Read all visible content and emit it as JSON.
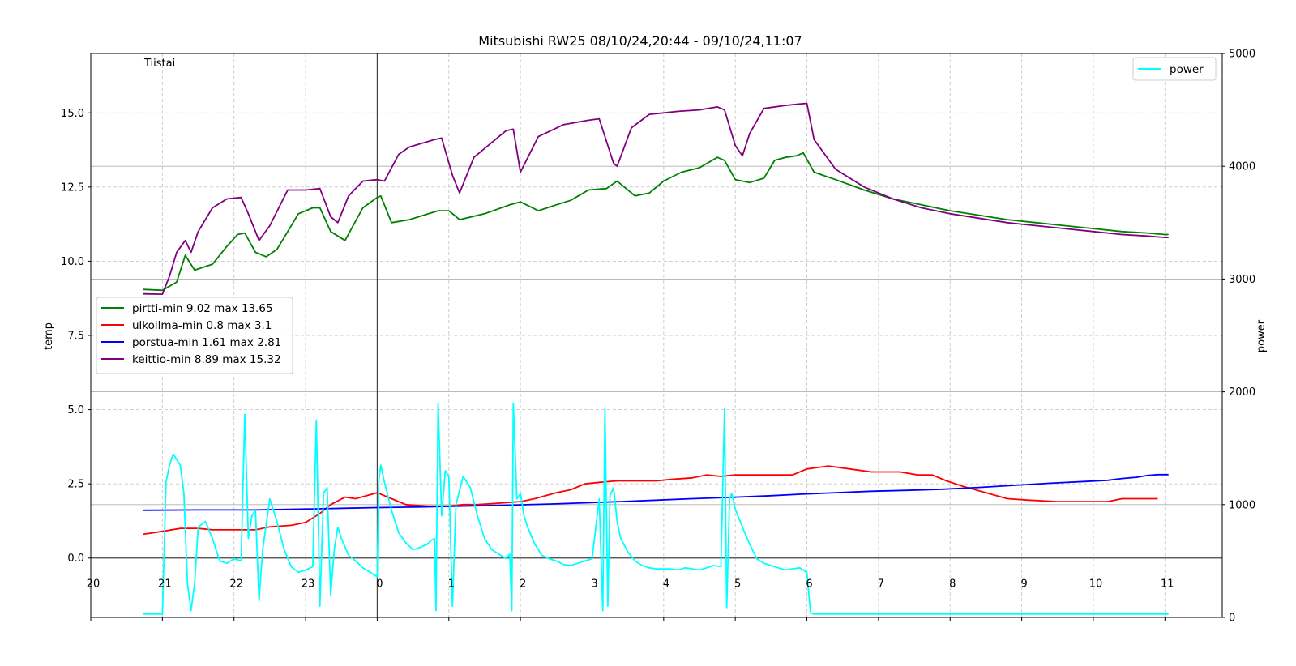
{
  "chart_data": {
    "type": "line",
    "title": "Mitsubishi RW25 08/10/24,20:44 - 09/10/24,11:07",
    "day_label": "Tiistai",
    "ylabel_left": "temp",
    "ylabel_right": "power",
    "xlim": [
      20,
      11.8
    ],
    "ylim_left": [
      -2.0,
      17.0
    ],
    "ylim_right": [
      0,
      5000
    ],
    "x_ticks": [
      "20",
      "21",
      "22",
      "23",
      "0",
      "1",
      "2",
      "3",
      "4",
      "5",
      "6",
      "7",
      "8",
      "9",
      "10",
      "11"
    ],
    "y_ticks_left": [
      "0.0",
      "2.5",
      "5.0",
      "7.5",
      "10.0",
      "12.5",
      "15.0"
    ],
    "y_ticks_right": [
      "0",
      "1000",
      "2000",
      "3000",
      "4000",
      "5000"
    ],
    "grid": true,
    "midnight_marker": 24.0,
    "right_legend": {
      "placement": "top-right",
      "entries": [
        "power"
      ]
    },
    "left_legend": {
      "placement": "center-left"
    },
    "colors": {
      "pirtti": "#008000",
      "ulkoilma": "#ff0000",
      "porstua": "#0000ff",
      "keittio": "#800080",
      "power": "#00ffff",
      "day_label": "#0000cc"
    },
    "series": [
      {
        "key": "pirtti",
        "name": "pirtti-min 9.02 max 13.65",
        "axis": "left",
        "x": [
          20.73,
          21.0,
          21.2,
          21.32,
          21.45,
          21.7,
          21.9,
          22.05,
          22.15,
          22.3,
          22.45,
          22.6,
          22.75,
          22.9,
          23.1,
          23.2,
          23.35,
          23.55,
          23.8,
          24.0,
          24.05,
          24.2,
          24.45,
          24.85,
          25.0,
          25.15,
          25.5,
          25.85,
          26.0,
          26.25,
          26.5,
          26.7,
          26.95,
          27.2,
          27.35,
          27.6,
          27.8,
          28.0,
          28.25,
          28.5,
          28.75,
          28.85,
          29.0,
          29.2,
          29.4,
          29.55,
          29.7,
          29.85,
          29.95,
          30.1,
          30.4,
          30.8,
          31.2,
          31.6,
          32.0,
          32.4,
          32.8,
          33.2,
          33.6,
          34.0,
          34.4,
          34.75,
          35.0,
          35.05
        ],
        "values": [
          9.05,
          9.02,
          9.3,
          10.2,
          9.7,
          9.9,
          10.5,
          10.9,
          10.95,
          10.3,
          10.15,
          10.4,
          11.0,
          11.6,
          11.8,
          11.8,
          11.0,
          10.7,
          11.8,
          12.15,
          12.2,
          11.3,
          11.4,
          11.7,
          11.7,
          11.4,
          11.6,
          11.9,
          12.0,
          11.7,
          11.9,
          12.05,
          12.4,
          12.45,
          12.7,
          12.2,
          12.3,
          12.7,
          13.0,
          13.15,
          13.5,
          13.4,
          12.75,
          12.65,
          12.8,
          13.4,
          13.5,
          13.55,
          13.65,
          13.0,
          12.75,
          12.4,
          12.1,
          11.9,
          11.7,
          11.55,
          11.4,
          11.3,
          11.2,
          11.1,
          11.0,
          10.95,
          10.9,
          10.9
        ]
      },
      {
        "key": "ulkoilma",
        "name": "ulkoilma-min 0.8 max 3.1",
        "axis": "left",
        "x": [
          20.73,
          21.0,
          21.25,
          21.5,
          21.7,
          22.0,
          22.3,
          22.5,
          22.8,
          23.0,
          23.2,
          23.35,
          23.55,
          23.7,
          24.0,
          24.2,
          24.4,
          24.7,
          25.0,
          25.2,
          25.4,
          25.7,
          26.0,
          26.2,
          26.5,
          26.7,
          26.9,
          27.1,
          27.35,
          27.6,
          27.9,
          28.1,
          28.4,
          28.6,
          28.8,
          29.0,
          29.3,
          29.6,
          29.8,
          30.0,
          30.3,
          30.6,
          30.9,
          31.1,
          31.3,
          31.55,
          31.75,
          31.95,
          32.2,
          32.5,
          32.8,
          33.1,
          33.5,
          33.9,
          34.2,
          34.4,
          34.6,
          34.9
        ],
        "values": [
          0.8,
          0.9,
          1.0,
          1.0,
          0.95,
          0.95,
          0.95,
          1.05,
          1.1,
          1.2,
          1.5,
          1.8,
          2.05,
          2.0,
          2.2,
          2.0,
          1.8,
          1.75,
          1.75,
          1.8,
          1.8,
          1.85,
          1.9,
          2.0,
          2.2,
          2.3,
          2.5,
          2.55,
          2.6,
          2.6,
          2.6,
          2.65,
          2.7,
          2.8,
          2.75,
          2.8,
          2.8,
          2.8,
          2.8,
          3.0,
          3.1,
          3.0,
          2.9,
          2.9,
          2.9,
          2.8,
          2.8,
          2.6,
          2.4,
          2.2,
          2.0,
          1.95,
          1.9,
          1.9,
          1.9,
          2.0,
          2.0,
          2.0
        ]
      },
      {
        "key": "porstua",
        "name": "porstua-min 1.61 max 2.81",
        "axis": "left",
        "x": [
          20.73,
          21.5,
          22.3,
          23.0,
          23.6,
          24.0,
          24.6,
          25.2,
          25.8,
          26.4,
          26.9,
          27.4,
          27.9,
          28.4,
          29.0,
          29.5,
          29.9,
          30.4,
          30.9,
          31.4,
          31.9,
          32.4,
          32.9,
          33.4,
          33.9,
          34.2,
          34.4,
          34.6,
          34.75,
          34.9,
          35.05
        ],
        "values": [
          1.61,
          1.62,
          1.62,
          1.65,
          1.68,
          1.7,
          1.72,
          1.75,
          1.78,
          1.82,
          1.86,
          1.9,
          1.95,
          2.0,
          2.05,
          2.1,
          2.15,
          2.2,
          2.25,
          2.28,
          2.32,
          2.38,
          2.45,
          2.52,
          2.58,
          2.62,
          2.68,
          2.72,
          2.78,
          2.81,
          2.81
        ]
      },
      {
        "key": "keittio",
        "name": "keittio-min 8.89 max 15.32",
        "axis": "left",
        "x": [
          20.73,
          21.0,
          21.1,
          21.2,
          21.32,
          21.4,
          21.5,
          21.7,
          21.9,
          22.1,
          22.2,
          22.35,
          22.5,
          22.75,
          23.0,
          23.2,
          23.35,
          23.45,
          23.6,
          23.8,
          24.0,
          24.1,
          24.3,
          24.45,
          24.8,
          24.9,
          25.05,
          25.15,
          25.35,
          25.8,
          25.9,
          26.0,
          26.25,
          26.6,
          26.95,
          27.1,
          27.3,
          27.35,
          27.55,
          27.8,
          28.0,
          28.2,
          28.5,
          28.75,
          28.85,
          29.0,
          29.1,
          29.2,
          29.4,
          29.7,
          29.9,
          30.0,
          30.1,
          30.4,
          30.8,
          31.2,
          31.6,
          32.0,
          32.4,
          32.8,
          33.2,
          33.6,
          34.0,
          34.4,
          34.75,
          35.0,
          35.05
        ],
        "values": [
          8.9,
          8.89,
          9.5,
          10.3,
          10.7,
          10.3,
          11.0,
          11.8,
          12.1,
          12.15,
          11.6,
          10.7,
          11.2,
          12.4,
          12.4,
          12.45,
          11.5,
          11.3,
          12.2,
          12.7,
          12.75,
          12.7,
          13.6,
          13.85,
          14.1,
          14.15,
          12.9,
          12.3,
          13.5,
          14.4,
          14.45,
          13.0,
          14.2,
          14.6,
          14.75,
          14.8,
          13.3,
          13.2,
          14.5,
          14.95,
          15.0,
          15.05,
          15.1,
          15.2,
          15.1,
          13.9,
          13.55,
          14.3,
          15.15,
          15.25,
          15.3,
          15.32,
          14.1,
          13.1,
          12.5,
          12.1,
          11.8,
          11.6,
          11.45,
          11.3,
          11.2,
          11.1,
          11.0,
          10.9,
          10.85,
          10.8,
          10.8
        ]
      },
      {
        "key": "power",
        "name": "power",
        "axis": "right",
        "x": [
          20.73,
          21.0,
          21.05,
          21.1,
          21.15,
          21.25,
          21.3,
          21.35,
          21.4,
          21.45,
          21.5,
          21.6,
          21.7,
          21.8,
          21.9,
          22.0,
          22.1,
          22.15,
          22.2,
          22.25,
          22.3,
          22.35,
          22.4,
          22.5,
          22.6,
          22.7,
          22.8,
          22.9,
          23.0,
          23.1,
          23.15,
          23.2,
          23.25,
          23.3,
          23.35,
          23.4,
          23.45,
          23.5,
          23.6,
          23.7,
          23.8,
          23.9,
          24.0,
          24.02,
          24.05,
          24.1,
          24.2,
          24.3,
          24.4,
          24.5,
          24.6,
          24.7,
          24.75,
          24.8,
          24.82,
          24.85,
          24.9,
          24.95,
          25.0,
          25.05,
          25.1,
          25.2,
          25.3,
          25.4,
          25.5,
          25.6,
          25.7,
          25.8,
          25.85,
          25.88,
          25.9,
          25.95,
          26.0,
          26.05,
          26.1,
          26.2,
          26.3,
          26.4,
          26.5,
          26.6,
          26.7,
          26.8,
          26.9,
          27.0,
          27.1,
          27.15,
          27.18,
          27.22,
          27.25,
          27.3,
          27.35,
          27.4,
          27.5,
          27.6,
          27.7,
          27.8,
          27.9,
          28.0,
          28.1,
          28.2,
          28.3,
          28.4,
          28.5,
          28.6,
          28.7,
          28.8,
          28.85,
          28.88,
          28.92,
          28.95,
          29.0,
          29.05,
          29.1,
          29.2,
          29.3,
          29.4,
          29.5,
          29.6,
          29.7,
          29.8,
          29.9,
          30.0,
          30.05,
          30.1,
          30.5,
          31.0,
          32.0,
          33.0,
          34.0,
          35.05
        ],
        "values": [
          30,
          30,
          1200,
          1350,
          1450,
          1350,
          1100,
          300,
          60,
          300,
          800,
          850,
          700,
          500,
          480,
          520,
          500,
          1800,
          700,
          900,
          950,
          150,
          600,
          1050,
          850,
          600,
          450,
          400,
          420,
          450,
          1750,
          100,
          1100,
          1150,
          200,
          600,
          800,
          700,
          550,
          500,
          440,
          400,
          360,
          1200,
          1350,
          1200,
          950,
          750,
          660,
          600,
          620,
          650,
          680,
          700,
          60,
          1900,
          900,
          1300,
          1250,
          100,
          1000,
          1250,
          1150,
          900,
          700,
          600,
          560,
          520,
          560,
          60,
          1900,
          1050,
          1100,
          900,
          800,
          650,
          550,
          520,
          500,
          470,
          460,
          480,
          500,
          520,
          1050,
          60,
          1850,
          100,
          1080,
          1150,
          850,
          700,
          580,
          500,
          460,
          440,
          430,
          430,
          430,
          420,
          440,
          430,
          420,
          440,
          460,
          450,
          1850,
          80,
          1050,
          1100,
          960,
          880,
          800,
          650,
          520,
          480,
          460,
          440,
          420,
          430,
          440,
          400,
          40,
          30,
          30,
          30,
          30,
          30,
          30,
          30
        ]
      }
    ]
  }
}
